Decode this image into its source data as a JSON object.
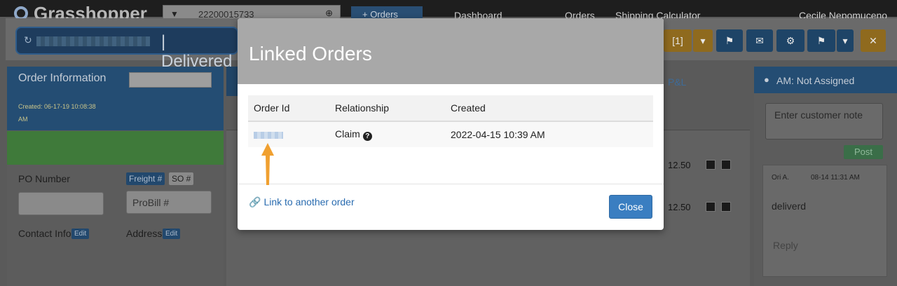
{
  "topnav": {
    "brand": "Grasshopper",
    "search_value": "22200015733",
    "orders_label": "+ Orders",
    "links": [
      "Dashboard",
      "Orders",
      "Shipping Calculator"
    ],
    "user": "Cecile Nepomuceno"
  },
  "order_header": {
    "status": "| Delivered",
    "linked_count": "[1]"
  },
  "left_panel": {
    "title": "Order Information",
    "created": "Created: 06-17-19 10:08:38 AM",
    "po_label": "PO Number",
    "freight_label": "Freight #",
    "so_label": "SO #",
    "probill_placeholder": "ProBill #",
    "contact_label": "Contact Info",
    "address_label": "Address",
    "edit_label": "Edit"
  },
  "mid": {
    "pl_label": "P&L",
    "row_values": [
      "12.50",
      "12.50"
    ]
  },
  "right_panel": {
    "am_label": "AM: Not Assigned",
    "note_placeholder": "Enter customer note",
    "post_label": "Post",
    "comment_author": "Ori A.",
    "comment_time": "08-14 11:31 AM",
    "comment_text": "deliverd",
    "reply_label": "Reply"
  },
  "modal": {
    "title": "Linked Orders",
    "columns": [
      "Order Id",
      "Relationship",
      "Created"
    ],
    "rows": [
      {
        "relationship": "Claim",
        "created": "2022-04-15 10:39 AM"
      }
    ],
    "link_label": "Link to another order",
    "close_label": "Close"
  },
  "colors": {
    "accent_blue": "#3a7ec1",
    "arrow_orange": "#f0a030"
  }
}
